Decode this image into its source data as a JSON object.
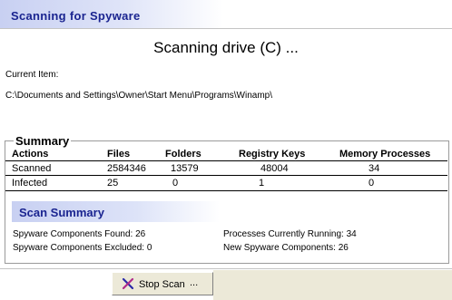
{
  "header": {
    "title": "Scanning for Spyware"
  },
  "status": {
    "message": "Scanning drive (C) ...",
    "current_item_label": "Current Item:",
    "current_item_path": "C:\\Documents and Settings\\Owner\\Start Menu\\Programs\\Winamp\\"
  },
  "summary": {
    "title": "Summary",
    "columns": [
      "Actions",
      "Files",
      "Folders",
      "Registry Keys",
      "Memory Processes"
    ],
    "rows": [
      {
        "label": "Scanned",
        "files": "2584346",
        "folders": "13579",
        "registry": "48004",
        "memory": "34"
      },
      {
        "label": "Infected",
        "files": "25",
        "folders": "0",
        "registry": "1",
        "memory": "0"
      }
    ]
  },
  "scan_summary": {
    "title": "Scan Summary",
    "found": "Spyware Components Found: 26",
    "excluded": "Spyware Components Excluded: 0",
    "running": "Processes Currently Running: 34",
    "new": "New Spyware Components: 26"
  },
  "footer": {
    "stop_label": "Stop Scan",
    "stop_dots": "...",
    "stop_icon": "x-icon"
  },
  "colors": {
    "accent": "#1a2490",
    "band_start": "#c8d0f2"
  }
}
